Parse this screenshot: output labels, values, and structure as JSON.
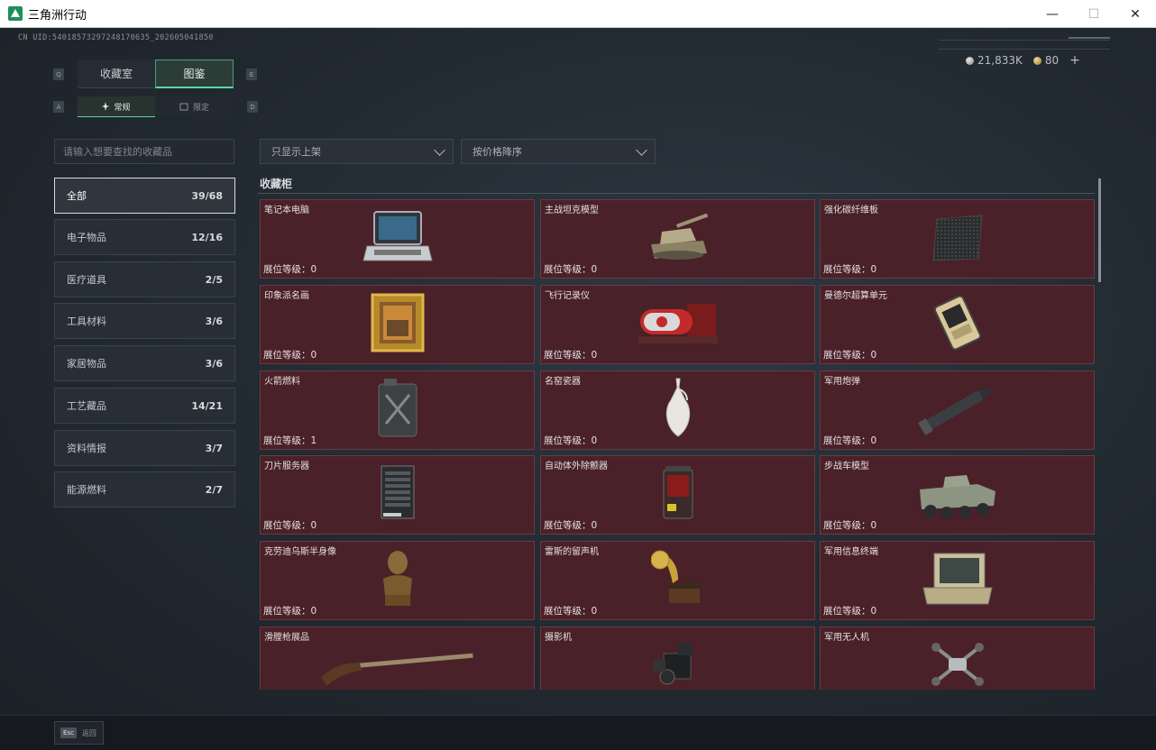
{
  "window": {
    "title": "三角洲行动",
    "minimize": "—",
    "maximize": "☐",
    "close": "✕"
  },
  "uid": "CN UID:540185732972481706​35_202605041850",
  "currency": {
    "coins": "21,833K",
    "gems": "80",
    "add": "+"
  },
  "tabs": {
    "left_key": "Q",
    "right_key": "E",
    "main": [
      "收藏室",
      "图鉴"
    ],
    "sub_left_key": "A",
    "sub_right_key": "D",
    "sub": [
      "常规",
      "限定"
    ]
  },
  "search": {
    "placeholder": "请输入想要查找的收藏品"
  },
  "filters": {
    "shelf": "只显示上架",
    "sort": "按价格降序"
  },
  "categories": [
    {
      "label": "全部",
      "count": "39/68"
    },
    {
      "label": "电子物品",
      "count": "12/16"
    },
    {
      "label": "医疗道具",
      "count": "2/5"
    },
    {
      "label": "工具材料",
      "count": "3/6"
    },
    {
      "label": "家居物品",
      "count": "3/6"
    },
    {
      "label": "工艺藏品",
      "count": "14/21"
    },
    {
      "label": "资料情报",
      "count": "3/7"
    },
    {
      "label": "能源燃料",
      "count": "2/7"
    }
  ],
  "cabinet": {
    "title": "收藏柜",
    "items": [
      {
        "name": "笔记本电脑",
        "level": "展位等级：0",
        "icon": "laptop-icon"
      },
      {
        "name": "主战坦克模型",
        "level": "展位等级：0",
        "icon": "tank-icon"
      },
      {
        "name": "强化碳纤维板",
        "level": "展位等级：0",
        "icon": "carbon-plate-icon"
      },
      {
        "name": "印象派名画",
        "level": "展位等级：0",
        "icon": "painting-icon"
      },
      {
        "name": "飞行记录仪",
        "level": "展位等级：0",
        "icon": "flight-recorder-icon"
      },
      {
        "name": "曼德尔超算单元",
        "level": "展位等级：0",
        "icon": "supercomputer-icon"
      },
      {
        "name": "火箭燃料",
        "level": "展位等级：1",
        "icon": "fuel-can-icon"
      },
      {
        "name": "名窑瓷器",
        "level": "展位等级：0",
        "icon": "porcelain-vase-icon"
      },
      {
        "name": "军用炮弹",
        "level": "展位等级：0",
        "icon": "shell-icon"
      },
      {
        "name": "刀片服务器",
        "level": "展位等级：0",
        "icon": "server-icon"
      },
      {
        "name": "自动体外除颤器",
        "level": "展位等级：0",
        "icon": "defibrillator-icon"
      },
      {
        "name": "步战车模型",
        "level": "展位等级：0",
        "icon": "ifv-icon"
      },
      {
        "name": "克劳迪乌斯半身像",
        "level": "展位等级：0",
        "icon": "bust-icon"
      },
      {
        "name": "雷斯的留声机",
        "level": "展位等级：0",
        "icon": "gramophone-icon"
      },
      {
        "name": "军用信息终端",
        "level": "展位等级：0",
        "icon": "terminal-icon"
      },
      {
        "name": "滑膛枪展品",
        "level": "",
        "icon": "musket-icon"
      },
      {
        "name": "摄影机",
        "level": "",
        "icon": "camera-icon"
      },
      {
        "name": "军用无人机",
        "level": "",
        "icon": "drone-icon"
      }
    ]
  },
  "footer": {
    "esc_key": "Esc",
    "back": "返回"
  }
}
